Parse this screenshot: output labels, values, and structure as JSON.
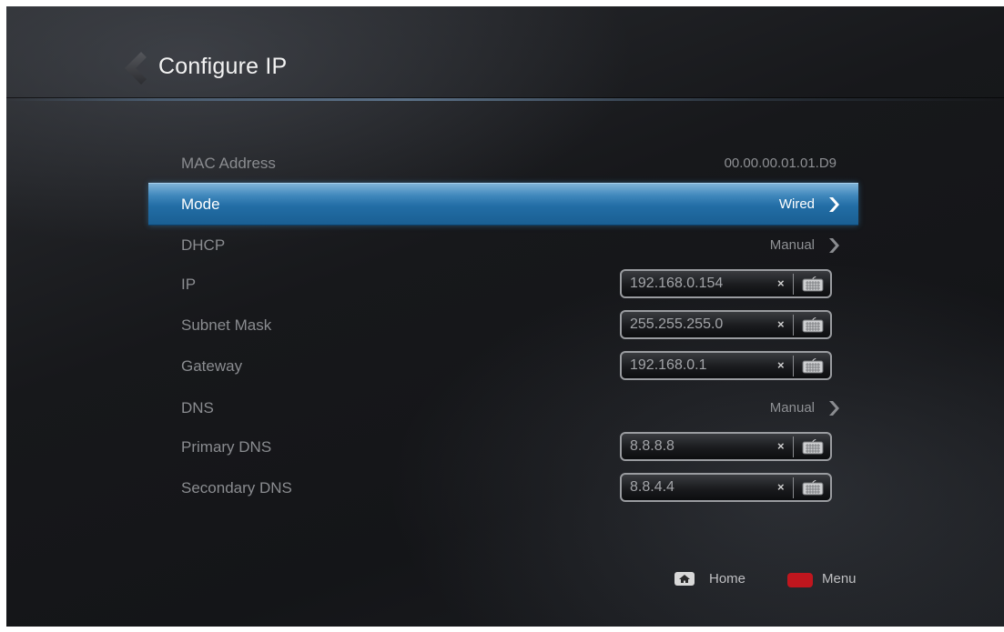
{
  "header": {
    "title": "Configure IP",
    "back_icon": "chevron-left-icon"
  },
  "rows": {
    "mac": {
      "label": "MAC Address",
      "value": "00.00.00.01.01.D9"
    },
    "mode": {
      "label": "Mode",
      "value": "Wired"
    },
    "dhcp": {
      "label": "DHCP",
      "value": "Manual"
    },
    "ip": {
      "label": "IP",
      "value": "192.168.0.154"
    },
    "subnet": {
      "label": "Subnet Mask",
      "value": "255.255.255.0"
    },
    "gateway": {
      "label": "Gateway",
      "value": "192.168.0.1"
    },
    "dns": {
      "label": "DNS",
      "value": "Manual"
    },
    "primary_dns": {
      "label": "Primary DNS",
      "value": "8.8.8.8"
    },
    "secondary_dns": {
      "label": "Secondary DNS",
      "value": "8.8.4.4"
    }
  },
  "field_controls": {
    "clear_glyph": "×",
    "keyboard_icon": "keyboard-icon"
  },
  "footer": {
    "home_label": "Home",
    "menu_label": "Menu",
    "home_icon": "home-icon",
    "menu_color": "#c0161e"
  },
  "colors": {
    "selection": "#226da5",
    "label_text": "#8a8c90",
    "background": "#17181b"
  }
}
